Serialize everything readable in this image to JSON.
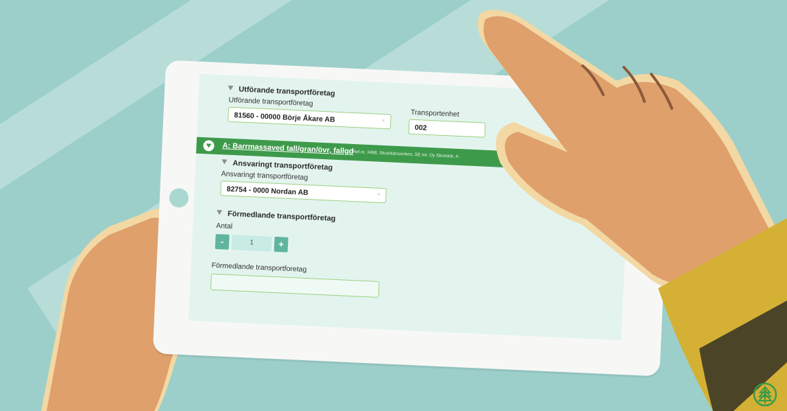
{
  "form": {
    "utforande_section": {
      "title": "Utförande transportföretag",
      "field_label": "Utförande transportföretag",
      "field_value": "81560 - 00000 Börje Åkare AB",
      "unit_label": "Transportenhet",
      "unit_value": "002"
    },
    "assortment_bar": {
      "title": "A: Barrmassaved tall/gran/övr, fallgd",
      "ref": "Ref.nr. 3498, Skutskärsverken, SE Int. Oy Skutskär, A"
    },
    "ansvarigt_section": {
      "title": "Ansvaringt transportföretag",
      "field_label": "Ansvaringt transportföretag",
      "field_value": "82754 - 0000 Nordan AB"
    },
    "formedlande_section": {
      "title": "Förmedlande transportföretag",
      "antal_label": "Antal",
      "antal_value": "1",
      "minus": "-",
      "plus": "+",
      "field_label": "Förmedlande transportforetag",
      "field_value": ""
    },
    "required_marker": "*"
  },
  "colors": {
    "background": "#9ccfc9",
    "screen": "#e3f4ef",
    "bar": "#3e9a4b",
    "field_border": "#9ad07e",
    "stepper": "#5fb59d",
    "skin": "#dfa06c",
    "sleeve": "#d4b035"
  },
  "icons": {
    "collapse": "triangle-down-icon",
    "expand": "circle-chevron-down-icon",
    "logo": "tree-logo-icon"
  }
}
